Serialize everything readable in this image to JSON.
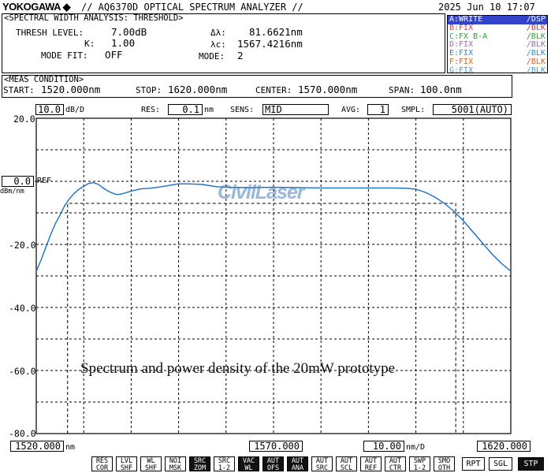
{
  "header": {
    "brand": "YOKOGAWA ◆",
    "title": "// AQ6370D OPTICAL SPECTRUM ANALYZER //",
    "datetime": "2025 Jun 10 17:07"
  },
  "analysis": {
    "title": "<SPECTRAL WIDTH ANALYSIS: THRESHOLD>",
    "thresh_label": "THRESH LEVEL:",
    "thresh_value": "7.00dB",
    "k_label": "K:",
    "k_value": "1.00",
    "modefit_label": "MODE FIT:",
    "modefit_value": "OFF",
    "delta_label": "Δλ:",
    "delta_value": "81.6621nm",
    "center_label": "λc:",
    "center_value": "1567.4216nm",
    "mode_label": "MODE:",
    "mode_value": "2"
  },
  "traces": [
    {
      "left": "A:WRITE",
      "right": "/DSP",
      "color": "#ffffff",
      "active": true
    },
    {
      "left": "B:FIX",
      "right": "/BLK",
      "color": "#d43a3a",
      "active": false
    },
    {
      "left": "C:FX B-A",
      "right": "/BLK",
      "color": "#33a033",
      "active": false
    },
    {
      "left": "D:FIX",
      "right": "/BLK",
      "color": "#9a6ab0",
      "active": false
    },
    {
      "left": "E:FIX",
      "right": "/BLK",
      "color": "#1f8fd8",
      "active": false
    },
    {
      "left": "F:FIX",
      "right": "/BLK",
      "color": "#e06020",
      "active": false
    },
    {
      "left": "G:FIX",
      "right": "/BLK",
      "color": "#3a9ad8",
      "active": false
    }
  ],
  "meas": {
    "title": "<MEAS CONDITION>",
    "start_label": "START:",
    "start_value": "1520.000nm",
    "stop_label": "STOP:",
    "stop_value": "1620.000nm",
    "center_label": "CENTER:",
    "center_value": "1570.000nm",
    "span_label": "SPAN:",
    "span_value": "100.0nm"
  },
  "settings": {
    "scale_value": "10.0",
    "scale_unit": "dB/D",
    "res_label": "RES:",
    "res_value": "0.1",
    "res_unit": "nm",
    "sens_label": "SENS:",
    "sens_value": "MID",
    "avg_label": "AVG:",
    "avg_value": "1",
    "smpl_label": "SMPL:",
    "smpl_value": "5001(AUTO)"
  },
  "ref": {
    "value": "0.0",
    "label": "REF",
    "unit": "dBm/nm"
  },
  "watermark": "CivilLaser",
  "caption": "Spectrum and power density of the 20mW prototype",
  "x_axis": {
    "start": "1520.000",
    "start_unit": "nm",
    "center": "1570.000",
    "div_value": "10.00",
    "div_unit": "nm/D",
    "stop": "1620.000"
  },
  "chart_data": {
    "type": "line",
    "xlabel": "",
    "ylabel": "",
    "xlim": [
      1520,
      1620
    ],
    "ylim": [
      -80,
      20
    ],
    "y_ticks": [
      "20.0",
      "-20.0",
      "-40.0",
      "-60.0",
      "-80.0"
    ],
    "grid": true,
    "line_color": "#1a6fc4",
    "threshold_level": -7.0,
    "threshold_x": [
      1526.6,
      1608.4
    ],
    "series": [
      {
        "x": [
          1520,
          1521,
          1522,
          1523,
          1524,
          1525,
          1526,
          1527,
          1528,
          1529,
          1530,
          1531,
          1532,
          1533,
          1534,
          1535,
          1536,
          1537,
          1538,
          1540,
          1542,
          1544,
          1546,
          1548,
          1550,
          1552,
          1555,
          1558,
          1560,
          1565,
          1570,
          1575,
          1580,
          1585,
          1590,
          1595,
          1598,
          1600,
          1602,
          1604,
          1606,
          1608,
          1610,
          1612,
          1614,
          1616,
          1618,
          1620
        ],
        "y": [
          -28.5,
          -25.0,
          -21.0,
          -17.0,
          -13.5,
          -10.7,
          -7.7,
          -5.5,
          -3.8,
          -2.5,
          -1.6,
          -0.7,
          -0.4,
          -0.9,
          -2.0,
          -3.0,
          -3.7,
          -4.2,
          -4.0,
          -3.1,
          -2.4,
          -2.2,
          -1.8,
          -1.3,
          -0.8,
          -0.8,
          -1.0,
          -1.7,
          -1.9,
          -2.0,
          -1.9,
          -2.0,
          -2.1,
          -2.1,
          -2.1,
          -2.1,
          -2.2,
          -2.5,
          -3.5,
          -5.0,
          -7.0,
          -9.5,
          -12.5,
          -16.0,
          -19.5,
          -23.0,
          -26.0,
          -28.5
        ]
      }
    ]
  }
}
